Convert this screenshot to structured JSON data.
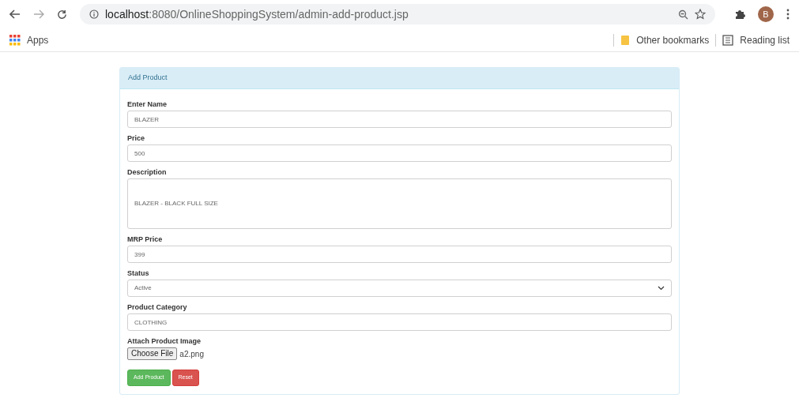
{
  "browser": {
    "url": "**localhost**:8080/OnlineShoppingSystem/admin-add-product.jsp",
    "profile_initial": "B",
    "bookmarks": [
      {
        "label": "Apps",
        "kind": "apps"
      }
    ],
    "bookmarks_right": [
      {
        "label": "Other bookmarks",
        "kind": "folder"
      },
      {
        "label": "Reading list",
        "kind": "reading"
      }
    ]
  },
  "panel": {
    "title": "Add Product",
    "fields": [
      {
        "label": "Enter Name",
        "kind": "text",
        "value": "BLAZER"
      },
      {
        "label": "Price",
        "kind": "text",
        "value": "500"
      },
      {
        "label": "Description",
        "kind": "textarea",
        "value": "BLAZER - BLACK FULL SIZE"
      },
      {
        "label": "MRP Price",
        "kind": "text",
        "value": "399"
      },
      {
        "label": "Status",
        "kind": "select",
        "value": "Active"
      },
      {
        "label": "Product Category",
        "kind": "text",
        "value": "CLOTHING"
      },
      {
        "label": "Attach Product Image",
        "kind": "file",
        "button": "Choose File",
        "value": "a2.png"
      }
    ],
    "buttons": [
      {
        "label": "Add Product",
        "kind": "success"
      },
      {
        "label": "Reset",
        "kind": "danger"
      }
    ]
  }
}
